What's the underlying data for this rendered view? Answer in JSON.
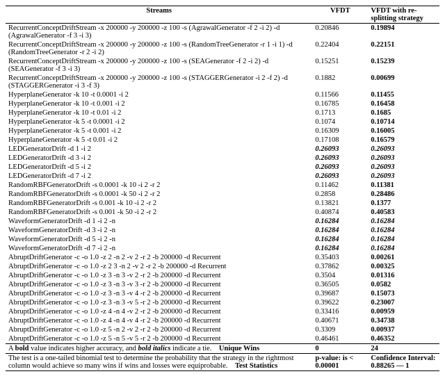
{
  "chart_data": {
    "type": "table",
    "title": "",
    "columns": [
      "Streams",
      "VFDT",
      "VFDT with re-splitting strategy"
    ],
    "winner_legend": [
      "plain",
      "bold = higher accuracy",
      "bold italic = tie"
    ],
    "rows": [
      {
        "stream": "RecurrentConceptDriftStream -x 200000 -y 200000 -z 100 -s (AgrawalGenerator -f 2 -i 2) -d (AgrawalGenerator -f 3 -i 3)",
        "v": "0.20846",
        "r": "0.19894",
        "w": "r"
      },
      {
        "stream": "RecurrentConceptDriftStream -x 200000 -y 200000 -z 100 -s (RandomTreeGenerator -r 1 -i 1) -d (RandomTreeGenerator -r 2 -i 2)",
        "v": "0.22404",
        "r": "0.22151",
        "w": "r"
      },
      {
        "stream": "RecurrentConceptDriftStream -x 200000 -y 200000 -z 100 -s (SEAGenerator -f 2 -i 2) -d (SEAGenerator -f 3 -i 3)",
        "v": "0.15251",
        "r": "0.15239",
        "w": "r"
      },
      {
        "stream": "RecurrentConceptDriftStream -x 200000 -y 200000 -z 100 -s (STAGGERGenerator -i 2 -f 2) -d (STAGGERGenerator -i 3 -f 3)",
        "v": "0.1882",
        "r": "0.00699",
        "w": "r"
      },
      {
        "stream": "HyperplaneGenerator -k 10 -t 0.0001 -i 2",
        "v": "0.11566",
        "r": "0.11455",
        "w": "r"
      },
      {
        "stream": "HyperplaneGenerator -k 10 -t 0.001 -i 2",
        "v": "0.16785",
        "r": "0.16458",
        "w": "r"
      },
      {
        "stream": "HyperplaneGenerator -k 10 -t 0.01 -i 2",
        "v": "0.1713",
        "r": "0.1685",
        "w": "r"
      },
      {
        "stream": "HyperplaneGenerator -k 5 -t 0.0001 -i 2",
        "v": "0.1074",
        "r": "0.10714",
        "w": "r"
      },
      {
        "stream": "HyperplaneGenerator -k 5 -t 0.001 -i 2",
        "v": "0.16309",
        "r": "0.16005",
        "w": "r"
      },
      {
        "stream": "HyperplaneGenerator -k 5 -t 0.01 -i 2",
        "v": "0.17108",
        "r": "0.16579",
        "w": "r"
      },
      {
        "stream": "LEDGeneratorDrift -d 1 -i 2",
        "v": "0.26093",
        "r": "0.26093",
        "w": "tie"
      },
      {
        "stream": "LEDGeneratorDrift -d 3 -i 2",
        "v": "0.26093",
        "r": "0.26093",
        "w": "tie"
      },
      {
        "stream": "LEDGeneratorDrift -d 5 -i 2",
        "v": "0.26093",
        "r": "0.26093",
        "w": "tie"
      },
      {
        "stream": "LEDGeneratorDrift -d 7 -i 2",
        "v": "0.26093",
        "r": "0.26093",
        "w": "tie"
      },
      {
        "stream": "RandomRBFGeneratorDrift -s 0.0001 -k 10 -i 2 -r 2",
        "v": "0.11462",
        "r": "0.11381",
        "w": "r"
      },
      {
        "stream": "RandomRBFGeneratorDrift -s 0.0001 -k 50 -i 2 -r 2",
        "v": "0.2858",
        "r": "0.28486",
        "w": "r"
      },
      {
        "stream": "RandomRBFGeneratorDrift -s 0.001 -k 10 -i 2 -r 2",
        "v": "0.13821",
        "r": "0.1377",
        "w": "r"
      },
      {
        "stream": "RandomRBFGeneratorDrift -s 0.001 -k 50 -i 2 -r 2",
        "v": "0.40874",
        "r": "0.40583",
        "w": "r"
      },
      {
        "stream": "WaveformGeneratorDrift -d 1 -i 2 -n",
        "v": "0.16284",
        "r": "0.16284",
        "w": "tie"
      },
      {
        "stream": "WaveformGeneratorDrift -d 3 -i 2 -n",
        "v": "0.16284",
        "r": "0.16284",
        "w": "tie"
      },
      {
        "stream": "WaveformGeneratorDrift -d 5 -i 2 -n",
        "v": "0.16284",
        "r": "0.16284",
        "w": "tie"
      },
      {
        "stream": "WaveformGeneratorDrift -d 7 -i 2 -n",
        "v": "0.16284",
        "r": "0.16284",
        "w": "tie"
      },
      {
        "stream": "AbruptDriftGenerator -c -o 1.0 -z 2 -n 2 -v 2 -r 2 -b 200000 -d Recurrent",
        "v": "0.35403",
        "r": "0.00261",
        "w": "r"
      },
      {
        "stream": "AbruptDriftGenerator -c -o 1.0 -z 2 3 -n 2 -v 2 -r 2 -b 200000 -d Recurrent",
        "v": "0.37862",
        "r": "0.00325",
        "w": "r"
      },
      {
        "stream": "AbruptDriftGenerator -c -o 1.0 -z 3 -n 3 -v 2 -r 2 -b 200000 -d Recurrent",
        "v": "0.3504",
        "r": "0.01316",
        "w": "r"
      },
      {
        "stream": "AbruptDriftGenerator -c -o 1.0 -z 3 -n 3 -v 3 -r 2 -b 200000 -d Recurrent",
        "v": "0.36505",
        "r": "0.0582",
        "w": "r"
      },
      {
        "stream": "AbruptDriftGenerator -c -o 1.0 -z 3 -n 3 -v 4 -r 2 -b 200000 -d Recurrent",
        "v": "0.39687",
        "r": "0.15073",
        "w": "r"
      },
      {
        "stream": "AbruptDriftGenerator -c -o 1.0 -z 3 -n 3 -v 5 -r 2 -b 200000 -d Recurrent",
        "v": "0.39622",
        "r": "0.23007",
        "w": "r"
      },
      {
        "stream": "AbruptDriftGenerator -c -o 1.0 -z 4 -n 4 -v 2 -r 2 -b 200000 -d Recurrent",
        "v": "0.33416",
        "r": "0.00959",
        "w": "r"
      },
      {
        "stream": "AbruptDriftGenerator -c -o 1.0 -z 4 -n 4 -v 4 -r 2 -b 200000 -d Recurrent",
        "v": "0.40671",
        "r": "0.34738",
        "w": "r"
      },
      {
        "stream": "AbruptDriftGenerator -c -o 1.0 -z 5 -n 2 -v 2 -r 2 -b 200000 -d Recurrent",
        "v": "0.3309",
        "r": "0.00937",
        "w": "r"
      },
      {
        "stream": "AbruptDriftGenerator -c -o 1.0 -z 5 -n 5 -v 5 -r 2 -b 200000 -d Recurrent",
        "v": "0.46461",
        "r": "0.46352",
        "w": "r"
      }
    ],
    "unique_wins": {
      "VFDT": 0,
      "VFDT_resplit": 24
    },
    "test_statistics": {
      "p_value": "< 0.00001",
      "confidence_interval": "0.88265 — 1"
    }
  },
  "head": {
    "streams": "Streams",
    "vfdt": "VFDT",
    "vfdt2": "VFDT with re-splitting strategy"
  },
  "notes": {
    "bold_note": "A bold value indicates higher accuracy, and bold italics indicate a tie.",
    "unique_wins_label": "Unique Wins",
    "unique_wins_v": "0",
    "unique_wins_r": "24",
    "test_note": "The test is a one-tailed binomial test to determine the probability that the strategy in the rightmost column would achieve so many wins if wins and losses were equiprobable.",
    "test_stats_label": "Test Statistics",
    "pvalue_label": "p-value: is < 0.00001",
    "ci_label": "Confidence Interval: 0.88265 — 1"
  }
}
